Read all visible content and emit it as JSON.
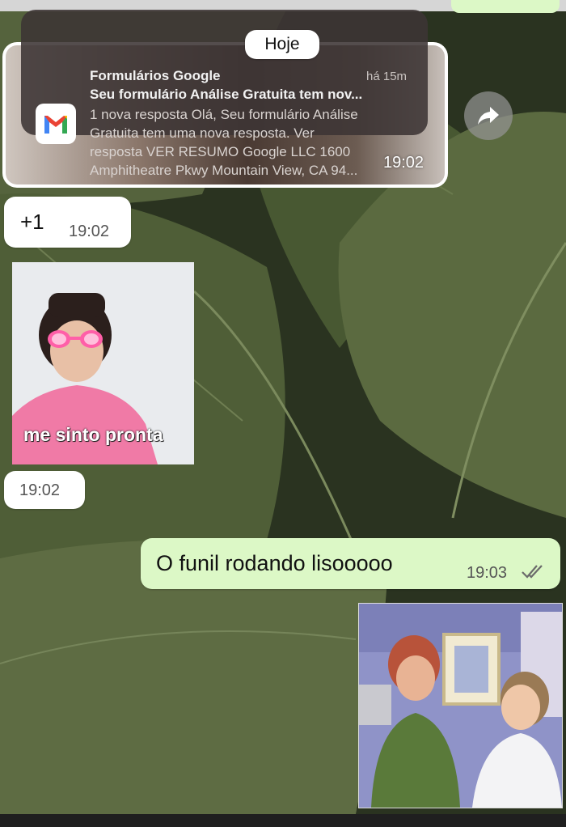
{
  "date_label": "Hoje",
  "notification": {
    "app_name": "Formulários Google",
    "age": "há 15m",
    "subject": "Seu formulário Análise Gratuita  tem nov...",
    "body_lines": [
      "1 nova resposta Olá, Seu formulário Análise",
      "Gratuita tem uma nova resposta. Ver",
      "resposta VER RESUMO Google LLC 1600",
      "Amphitheatre Pkwy Mountain View, CA 94..."
    ],
    "message_time": "19:02"
  },
  "plus_message": {
    "text": "+1",
    "time": "19:02"
  },
  "sticker": {
    "caption": "me sinto pronta",
    "time": "19:02"
  },
  "outgoing_message": {
    "text": "O funil rodando lisooooo",
    "time": "19:03",
    "status": "read"
  },
  "colors": {
    "outgoing_bubble": "#dcf8c6",
    "incoming_bubble": "#ffffff",
    "read_ticks": "#6b6b6b"
  }
}
